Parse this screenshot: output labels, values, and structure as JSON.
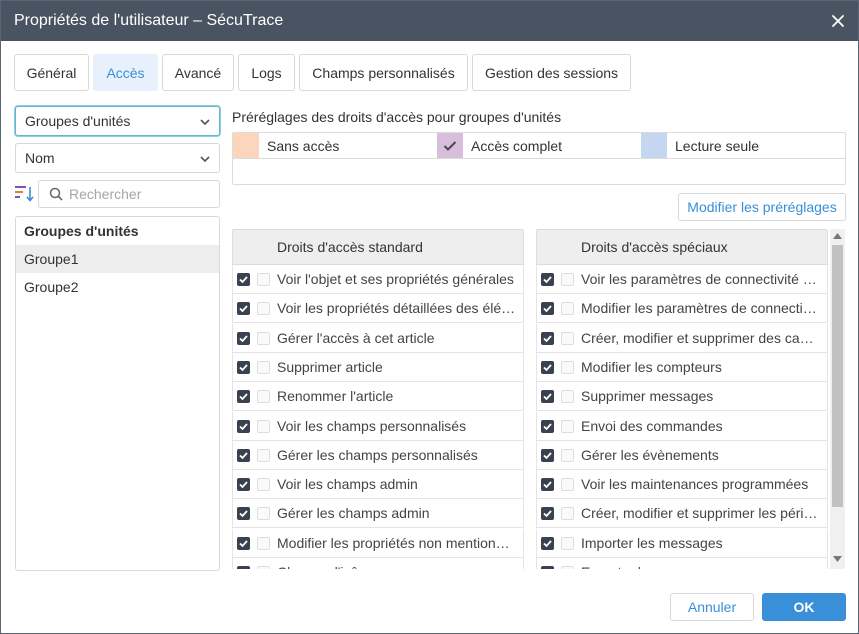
{
  "window": {
    "title": "Propriétés de l'utilisateur – SécuTrace"
  },
  "tabs": [
    {
      "label": "Général",
      "active": false
    },
    {
      "label": "Accès",
      "active": true
    },
    {
      "label": "Avancé",
      "active": false
    },
    {
      "label": "Logs",
      "active": false
    },
    {
      "label": "Champs personnalisés",
      "active": false
    },
    {
      "label": "Gestion des sessions",
      "active": false
    }
  ],
  "left": {
    "type_select": "Groupes d'unités",
    "sort_select": "Nom",
    "search_placeholder": "Rechercher",
    "list_header": "Groupes d'unités",
    "items": [
      "Groupe1",
      "Groupe2"
    ],
    "selected_index": 0
  },
  "presets": {
    "label": "Préréglages des droits d'accès pour groupes d'unités",
    "items": [
      {
        "label": "Sans accès",
        "color": "#fcd5bd"
      },
      {
        "label": "Accès complet",
        "color": "#d7bfdc"
      },
      {
        "label": "Lecture seule",
        "color": "#c5d7f0"
      }
    ],
    "edit_button": "Modifier les préréglages"
  },
  "standard": {
    "header": "Droits d'accès standard",
    "rows": [
      "Voir l'objet et ses propriétés générales",
      "Voir les propriétés détaillées des éléments",
      "Gérer l'accès à cet article",
      "Supprimer article",
      "Renommer l'article",
      "Voir les champs personnalisés",
      "Gérer les champs personnalisés",
      "Voir les champs admin",
      "Gérer les champs admin",
      "Modifier les propriétés non mentionnées",
      "Changer l'icône"
    ]
  },
  "special": {
    "header": "Droits d'accès spéciaux",
    "rows": [
      "Voir les paramètres de connectivité (type",
      "Modifier les paramètres de connectivité",
      "Créer, modifier et supprimer des capteurs",
      "Modifier les compteurs",
      "Supprimer messages",
      "Envoi des commandes",
      "Gérer les évènements",
      "Voir les maintenances programmées",
      "Créer, modifier et supprimer les périodes",
      "Importer les messages",
      "Exporter les messages"
    ]
  },
  "footer": {
    "cancel": "Annuler",
    "ok": "OK"
  },
  "colors": {
    "accent": "#3a8fd9",
    "titlebar": "#4a5361",
    "checkbox": "#3a4150"
  }
}
